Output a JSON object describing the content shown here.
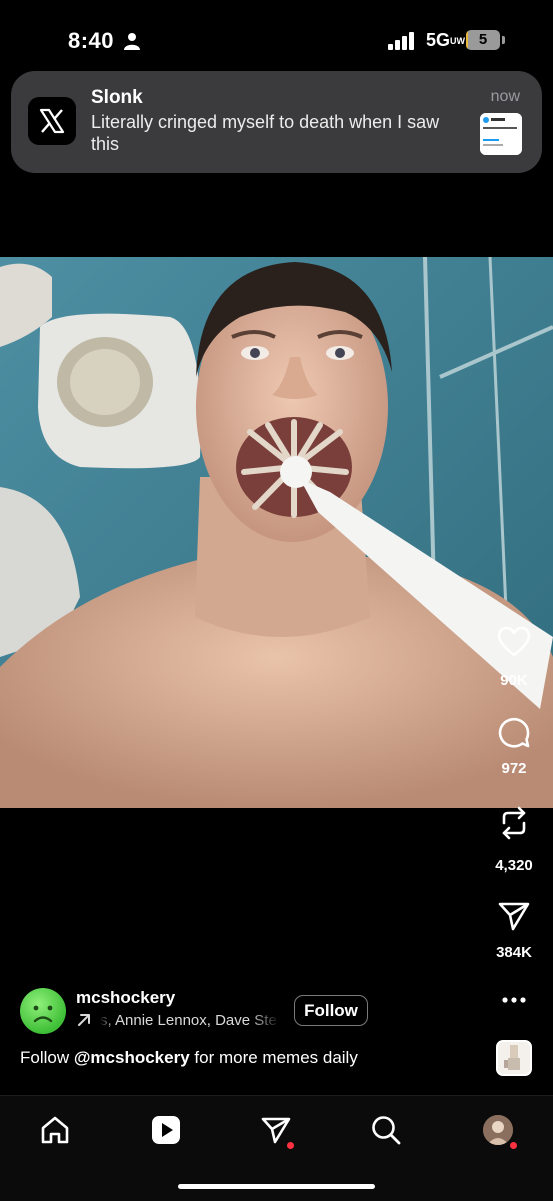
{
  "status_bar": {
    "time": "8:40",
    "network": "5G",
    "network_suffix": "UW",
    "battery_level": "5",
    "battery_fraction": 0.05
  },
  "notification": {
    "app_icon": "x-logo-icon",
    "sender": "Slonk",
    "message": "Literally cringed myself to death when I saw this",
    "time": "now"
  },
  "post": {
    "image_icon": "photo",
    "actions": {
      "like_count": "90K",
      "comment_count": "972",
      "repost_count": "4,320",
      "share_count": "384K"
    },
    "author": {
      "username": "mcshockery",
      "follow_label": "Follow",
      "audio_text": "s, Annie Lennox, Dave Ste"
    },
    "caption": {
      "prefix": "Follow ",
      "handle": "@mcshockery",
      "suffix": " for more memes daily"
    }
  },
  "colors": {
    "background": "#000000",
    "notification_bg": "#3b3b3d",
    "badge_red": "#ff3040",
    "battery_yellow": "#e9b83a"
  },
  "bottom_nav": [
    "home-icon",
    "reels-icon",
    "messages-icon",
    "search-icon",
    "profile-avatar"
  ]
}
